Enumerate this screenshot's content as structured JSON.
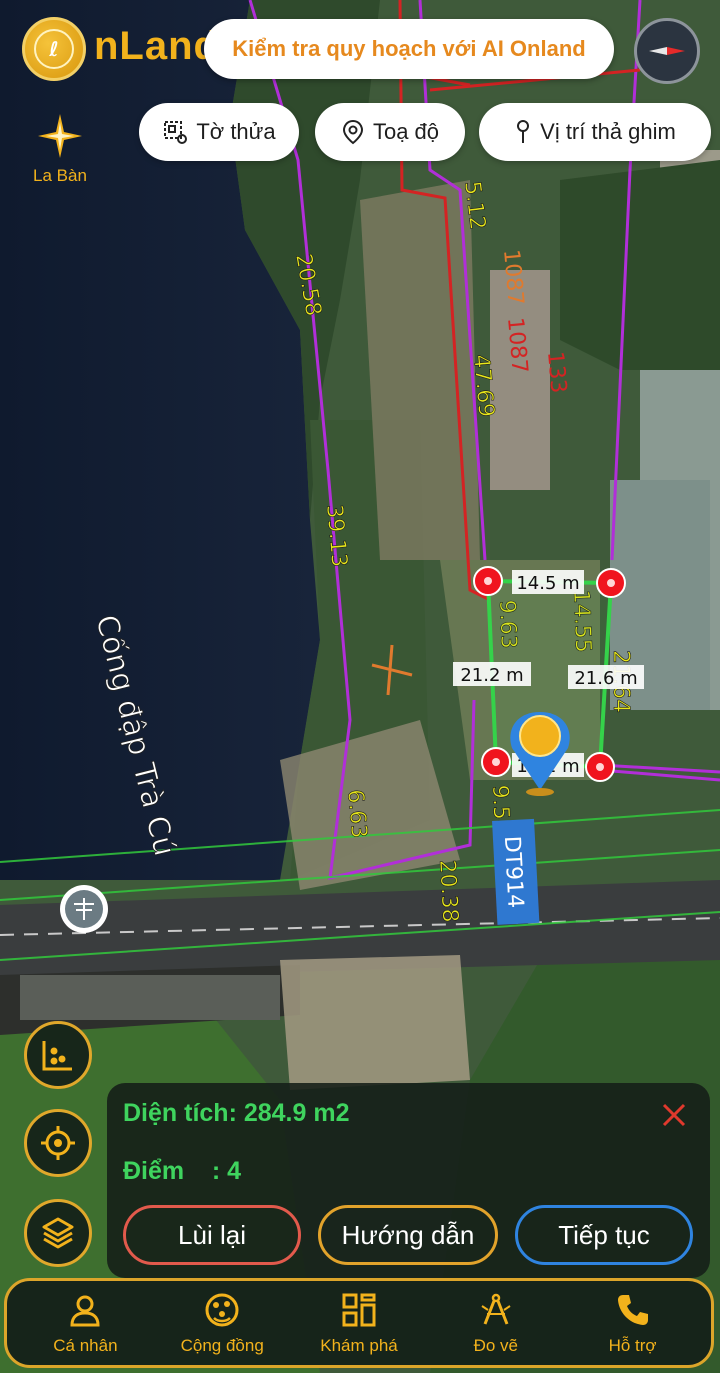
{
  "header": {
    "logo_text": "nLand",
    "ai_banner": "Kiểm tra quy hoạch với AI Onland",
    "compass_label": "La Bàn"
  },
  "chips": [
    {
      "label": "Tờ thửa",
      "icon": "parcel-icon"
    },
    {
      "label": "Toạ độ",
      "icon": "location-pin-icon"
    },
    {
      "label": "Vị trí thả ghim",
      "icon": "pushpin-icon"
    }
  ],
  "map": {
    "place_label": "Cống đập Trà Cú",
    "road_label": "DT914",
    "parcel_numbers": [
      "1087",
      "1087",
      "133"
    ],
    "edge_lengths": [
      "20.58",
      "39.13",
      "6.63",
      "20.38",
      "5.12",
      "47.69",
      "9.54",
      "9.63",
      "14.55",
      "21.64"
    ],
    "measure_labels": [
      "14.5 m",
      "21.2 m",
      "21.6 m",
      "12.2 m"
    ]
  },
  "panel": {
    "area_text": "Diện tích: 284.9 m2",
    "points_text": "Điểm    : 4",
    "back_label": "Lùi lại",
    "guide_label": "Hướng dẫn",
    "next_label": "Tiếp tục"
  },
  "nav": [
    {
      "label": "Cá nhân",
      "icon": "person-icon"
    },
    {
      "label": "Cộng đồng",
      "icon": "community-icon"
    },
    {
      "label": "Khám phá",
      "icon": "grid-explore-icon"
    },
    {
      "label": "Đo vẽ",
      "icon": "measure-compass-icon"
    },
    {
      "label": "Hỗ trợ",
      "icon": "phone-icon"
    }
  ],
  "colors": {
    "gold": "#f2b21c",
    "green_text": "#3fd45e",
    "parcel_purple": "#b12fd8",
    "measure_green": "#35d24a",
    "marker_red": "#f0141e",
    "label_yellow": "#e8e81a"
  }
}
